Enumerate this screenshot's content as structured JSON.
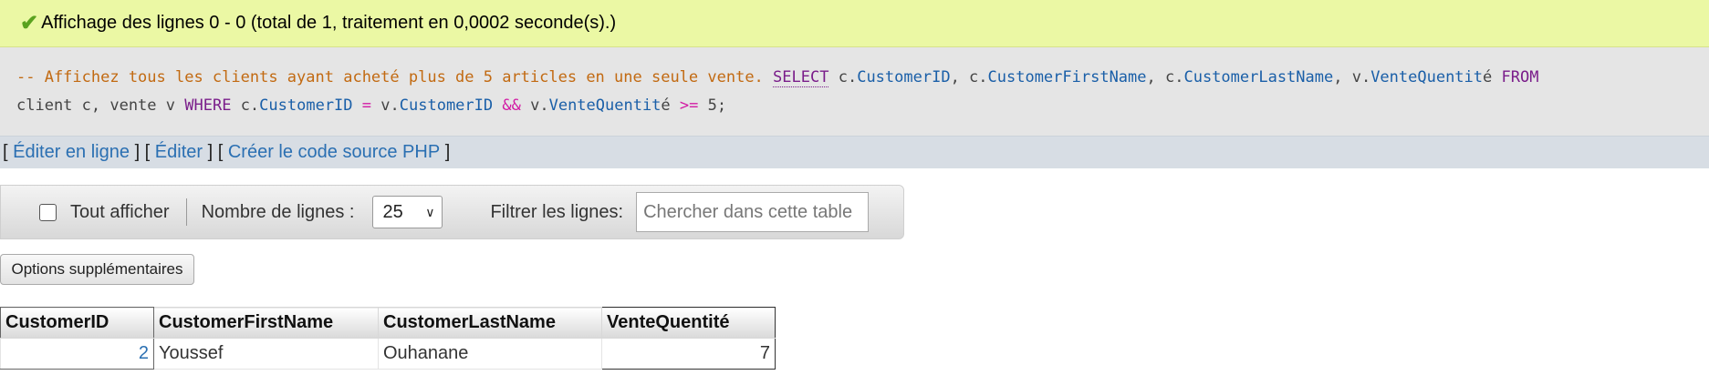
{
  "success": {
    "message": "Affichage des lignes 0 - 0 (total de 1, traitement en 0,0002 seconde(s).)",
    "icon": "check-icon"
  },
  "sql": {
    "comment": "-- Affichez tous les clients ayant acheté plus de 5 articles en une seule vente.",
    "select_kw": "SELECT",
    "t1": "c.",
    "col1": "CustomerID",
    "t2": ", c.",
    "col2": "CustomerFirstName",
    "t3": ", c.",
    "col3": "CustomerLastName",
    "t4": ", v.",
    "col4": "VenteQuentit",
    "t5": "é",
    "from_kw": "FROM",
    "t6": "client c, vente v",
    "where_kw": "WHERE",
    "t7": "c.",
    "col5": "CustomerID",
    "op_eq": "=",
    "t8": "v.",
    "col6": "CustomerID",
    "op_and": "&&",
    "t9": "v.",
    "col7": "VenteQuentit",
    "t10": "é",
    "op_ge": ">=",
    "num": "5",
    "end": ";"
  },
  "links": {
    "open1": "[",
    "edit_inline": "Éditer en ligne",
    "sep1": "] [",
    "edit": "Éditer",
    "sep2": "] [",
    "php": "Créer le code source PHP",
    "close": "]"
  },
  "nav": {
    "show_all_label": "Tout afficher",
    "rows_label": "Nombre de lignes :",
    "rows_value": "25",
    "filter_label": "Filtrer les lignes:",
    "search_placeholder": "Chercher dans cette table"
  },
  "options_button": "Options supplémentaires",
  "table": {
    "headers": [
      "CustomerID",
      "CustomerFirstName",
      "CustomerLastName",
      "VenteQuentité"
    ],
    "rows": [
      [
        "2",
        "Youssef",
        "Ouhanane",
        "7"
      ]
    ]
  },
  "colors": {
    "success_bg": "#ebf8a4",
    "sql_bg": "#e5e5e5",
    "link": "#2a6fb2",
    "sql_keyword": "#7a1d8a",
    "sql_column": "#1a5fa8",
    "sql_comment": "#c26a12",
    "sql_operator": "#d21aa4"
  }
}
